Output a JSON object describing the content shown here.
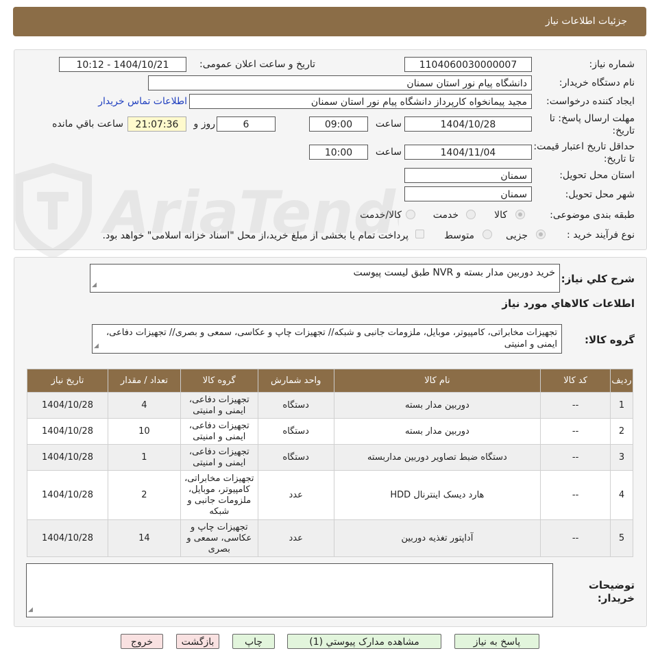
{
  "header": {
    "title": "جزئیات اطلاعات نیاز"
  },
  "form": {
    "need_number_label": "شماره نیاز:",
    "need_number": "1104060030000007",
    "announce_label": "تاریخ و ساعت اعلان عمومی:",
    "announce_value": "1404/10/21 - 10:12",
    "buyer_label": "نام دستگاه خریدار:",
    "buyer_value": "دانشگاه پیام نور استان سمنان",
    "requester_label": "ایجاد کننده درخواست:",
    "requester_value": "مجید پیمانخواه کارپرداز دانشگاه پیام نور استان سمنان",
    "contact_link": "اطلاعات تماس خریدار",
    "deadline_label": "مهلت ارسال پاسخ: تا تاریخ:",
    "deadline_date": "1404/10/28",
    "time_label": "ساعت",
    "deadline_time": "09:00",
    "days_value": "6",
    "days_label": "روز و",
    "remaining_time": "21:07:36",
    "remaining_label": "ساعت باقي مانده",
    "validity_label": "حداقل تاریخ اعتبار قیمت: تا تاریخ:",
    "validity_date": "1404/11/04",
    "validity_time": "10:00",
    "province_label": "استان محل تحویل:",
    "province_value": "سمنان",
    "city_label": "شهر محل تحویل:",
    "city_value": "سمنان",
    "category_label": "طبقه بندی موضوعی:",
    "category_options": [
      "کالا",
      "خدمت",
      "کالا/خدمت"
    ],
    "category_selected": "کالا",
    "process_label": "نوع فرآیند خرید :",
    "process_options": [
      "جزیی",
      "متوسط"
    ],
    "process_selected": "جزیی",
    "payment_note": "پرداخت تمام یا بخشی از مبلغ خرید،از محل \"اسناد خزانه اسلامی\" خواهد بود."
  },
  "description": {
    "label": "شرح کلي نياز:",
    "value": "خرید دوربین مدار بسته و NVR  طبق لیست پیوست"
  },
  "goods_section_title": "اطلاعات کالاهاي مورد نياز",
  "goods_group": {
    "label": "گروه کالا:",
    "value": "تجهیزات مخابراتی، کامپیوتر، موبایل، ملزومات جانبی و شبکه// تجهیزات چاپ و عکاسی، سمعی و بصری// تجهیزات دفاعی، ایمنی و امنیتی"
  },
  "table": {
    "headers": [
      "ردیف",
      "کد کالا",
      "نام کالا",
      "واحد شمارش",
      "گروه کالا",
      "تعداد / مقدار",
      "تاریخ نیاز"
    ],
    "rows": [
      [
        "1",
        "--",
        "دوربین مدار بسته",
        "دستگاه",
        "تجهیزات دفاعی، ایمنی و امنیتی",
        "4",
        "1404/10/28"
      ],
      [
        "2",
        "--",
        "دوربین مدار بسته",
        "دستگاه",
        "تجهیزات دفاعی، ایمنی و امنیتی",
        "10",
        "1404/10/28"
      ],
      [
        "3",
        "--",
        "دستگاه ضبط تصاویر دوربین مداربسته",
        "دستگاه",
        "تجهیزات دفاعی، ایمنی و امنیتی",
        "1",
        "1404/10/28"
      ],
      [
        "4",
        "--",
        "هارد دیسک اینترنال HDD",
        "عدد",
        "تجهیزات مخابراتی، کامپیوتر، موبایل، ملزومات جانبی و شبکه",
        "2",
        "1404/10/28"
      ],
      [
        "5",
        "--",
        "آداپتور تغذیه دوربین",
        "عدد",
        "تجهیزات چاپ و عکاسی، سمعی و بصری",
        "14",
        "1404/10/28"
      ]
    ]
  },
  "buyer_notes": {
    "label": "توضیحات خریدار:",
    "value": ""
  },
  "buttons": {
    "reply": "پاسخ به نیاز",
    "attachments": "مشاهده مدارک پیوستي (1)",
    "print": "چاپ",
    "back": "بازگشت",
    "exit": "خروج"
  },
  "watermark": {
    "text": "AriaTender.neT"
  },
  "colors": {
    "header_bg": "#8b6d47",
    "green_button": "#e2f5dc",
    "pink_button": "#f9e1e1",
    "link": "#1f3fbf"
  }
}
